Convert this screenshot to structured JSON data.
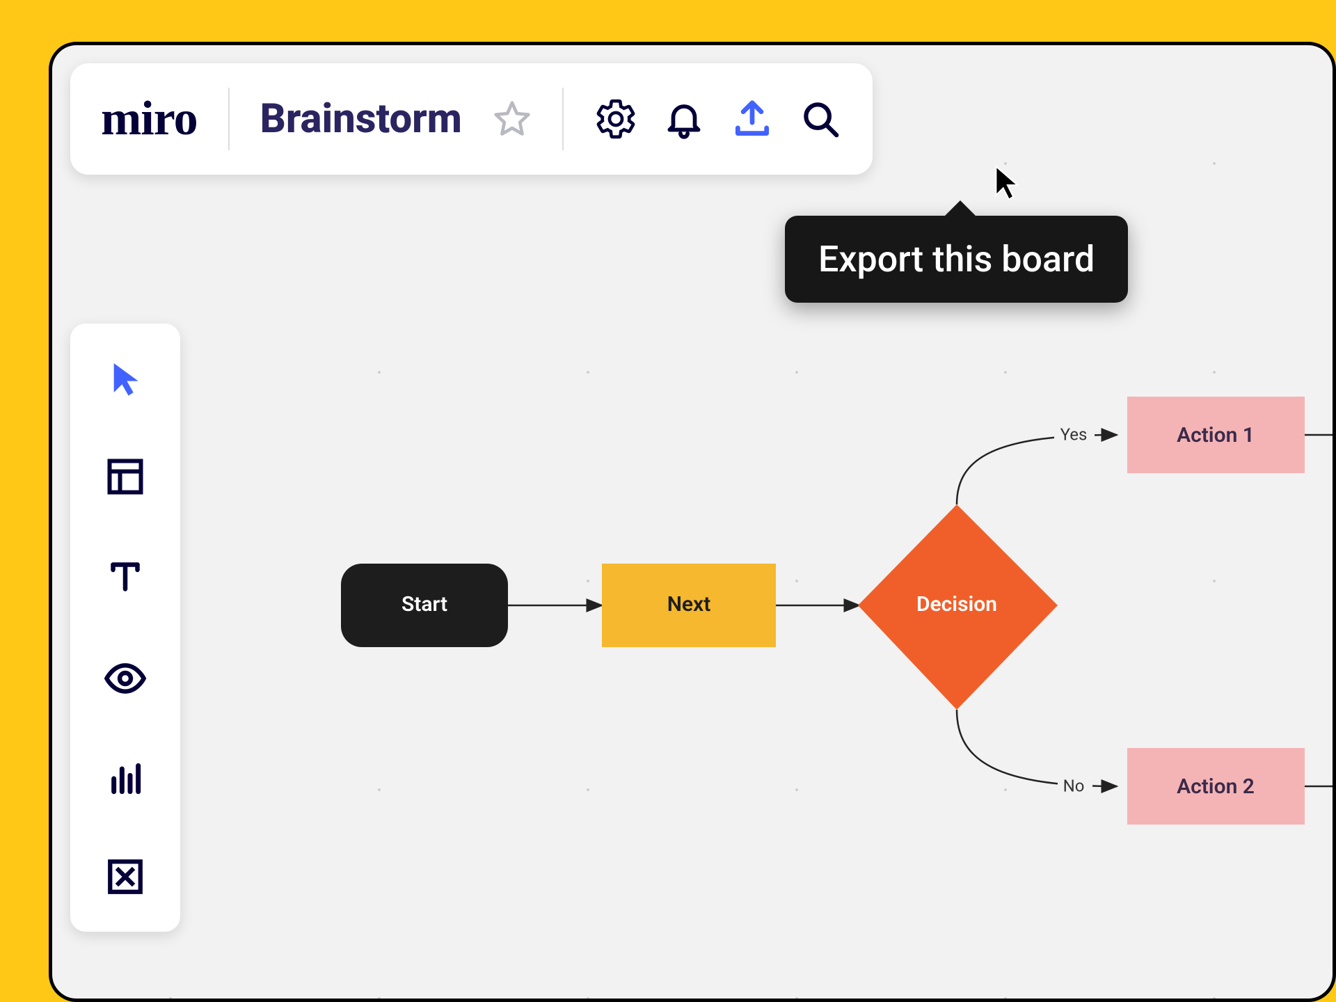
{
  "app": {
    "logo": "miro",
    "board_title": "Brainstorm"
  },
  "toolbar": {
    "settings_icon": "settings",
    "notifications_icon": "bell",
    "export_icon": "export",
    "search_icon": "search",
    "star_icon": "star",
    "export_tooltip": "Export this board"
  },
  "side_tools": [
    {
      "name": "select",
      "label": "Select"
    },
    {
      "name": "template",
      "label": "Template"
    },
    {
      "name": "text",
      "label": "Text"
    },
    {
      "name": "view",
      "label": "View"
    },
    {
      "name": "chart",
      "label": "Chart"
    },
    {
      "name": "delete",
      "label": "Delete"
    }
  ],
  "colors": {
    "accent_blue": "#4262ff",
    "node_dark": "#1d1d1d",
    "node_yellow": "#f5b82e",
    "node_orange": "#f05f2a",
    "node_pink": "#f4b4b6",
    "frame_yellow": "#ffc817"
  },
  "flow": {
    "nodes": {
      "start": {
        "label": "Start"
      },
      "next": {
        "label": "Next"
      },
      "decision": {
        "label": "Decision"
      },
      "action1": {
        "label": "Action 1"
      },
      "action2": {
        "label": "Action 2"
      }
    },
    "edges": {
      "yes": {
        "label": "Yes"
      },
      "no": {
        "label": "No"
      }
    }
  }
}
